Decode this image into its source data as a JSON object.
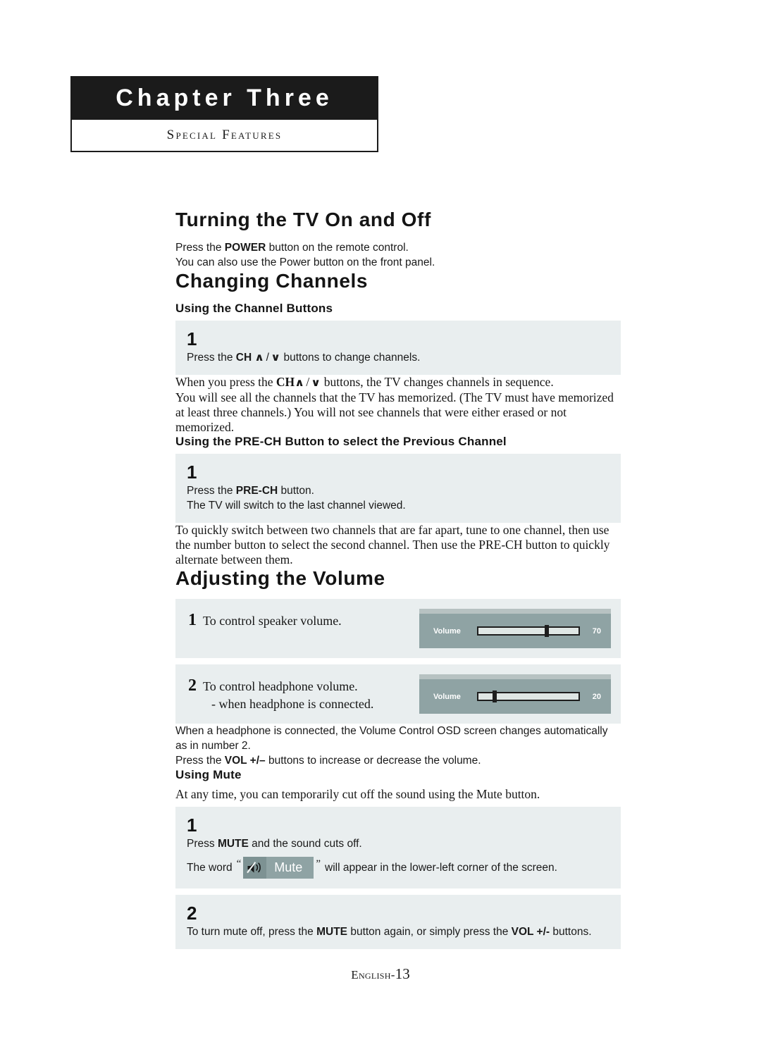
{
  "chapter": {
    "title": "Chapter Three",
    "subtitle": "Special Features"
  },
  "sections": {
    "turning_on_off": {
      "heading": "Turning the TV On and Off",
      "line1_pre": "Press the ",
      "line1_bold": "POWER",
      "line1_post": " button on the remote control.",
      "line2": "You can also use the Power button on the front panel."
    },
    "changing_channels": {
      "heading": "Changing Channels",
      "sub1_heading": "Using the Channel Buttons",
      "box1": {
        "number": "1",
        "text_pre": "Press the ",
        "text_bold": "CH",
        "chevron_up": "∧",
        "separator": "/",
        "chevron_down": "∨",
        "text_post": " buttons to change channels."
      },
      "body1_pre": "When you press the ",
      "body1_bold": "CH",
      "body1_post": " buttons, the TV changes channels in sequence.",
      "body2": "You will see all the channels that the TV has memorized. (The TV must have  memorized at least three channels.) You will not see channels that were either erased or not memorized.",
      "sub2_heading": "Using the PRE-CH Button to select the Previous Channel",
      "box2": {
        "number": "1",
        "line1_pre": "Press the ",
        "line1_bold": "PRE-CH",
        "line1_post": " button.",
        "line2": "The TV will switch to the last channel viewed."
      },
      "body3": "To quickly switch between two channels that are far apart, tune to one channel, then use the number button to select the second channel. Then use the PRE-CH button to quickly alternate between them."
    },
    "adjusting_volume": {
      "heading": "Adjusting the Volume",
      "step1": {
        "number": "1",
        "text": "To control speaker volume.",
        "osd": {
          "label": "Volume",
          "value": "70",
          "percent": 68
        }
      },
      "step2": {
        "number": "2",
        "text": "To control headphone volume.",
        "subtext": "- when headphone is connected.",
        "osd": {
          "label": "Volume",
          "value": "20",
          "percent": 16
        }
      },
      "note1": "When a headphone is connected, the Volume Control OSD screen changes automatically as in number 2.",
      "note2_pre": "Press the ",
      "note2_bold": "VOL +/–",
      "note2_post": " buttons to increase or decrease the volume."
    },
    "using_mute": {
      "heading": "Using Mute",
      "intro": "At any time, you can temporarily cut off the sound using the Mute button.",
      "box1": {
        "number": "1",
        "line1_pre": "Press ",
        "line1_bold": "MUTE",
        "line1_post": " and the sound cuts off.",
        "line2_pre": "The word",
        "quote_open": "“",
        "badge_label": "Mute",
        "quote_close": "”",
        "line2_post": "will appear in the lower-left corner of the screen."
      },
      "box2": {
        "number": "2",
        "text_pre": "To turn mute off, press the ",
        "text_bold1": "MUTE",
        "text_mid": " button again, or simply press the ",
        "text_bold2": "VOL +/-",
        "text_post": " buttons."
      }
    }
  },
  "footer": {
    "language": "English-",
    "page": "13"
  },
  "colors": {
    "header_bar": "#1b1b1b",
    "step_box": "#e9eeef",
    "osd_body": "#8fa3a4",
    "osd_top": "#b7c2c2",
    "osd_track": "#dfe6e4"
  }
}
